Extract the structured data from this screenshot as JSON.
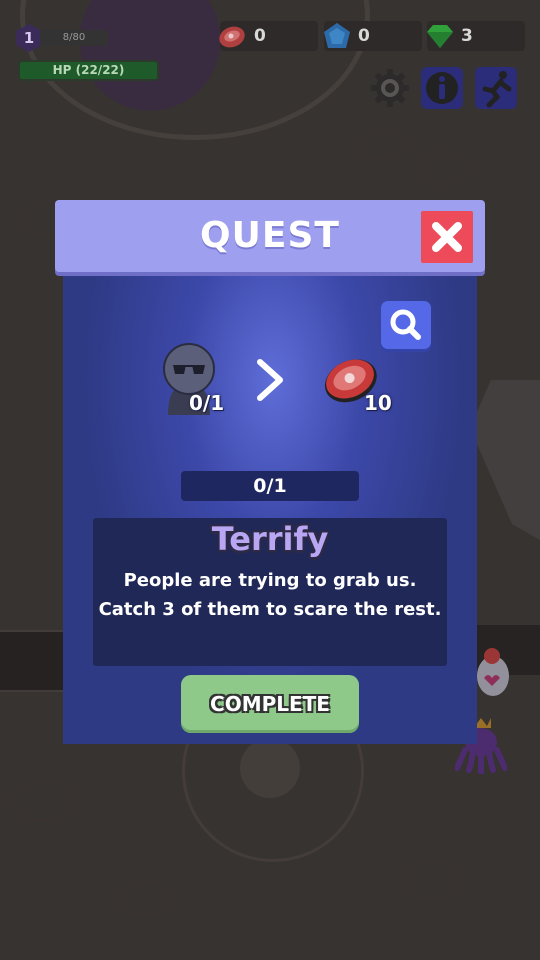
{
  "hud": {
    "level": "1",
    "xp": "8/80",
    "hp": "HP (22/22)",
    "resources": [
      {
        "name": "meat",
        "icon": "meat-icon",
        "value": "0"
      },
      {
        "name": "blue-gem",
        "icon": "blue-gem-icon",
        "value": "0"
      },
      {
        "name": "green-gem",
        "icon": "green-gem-icon",
        "value": "3"
      }
    ],
    "buttons": {
      "settings": "gear-icon",
      "info": "info-icon",
      "pose": "pose-icon"
    }
  },
  "quest": {
    "title": "QUEST",
    "target_count": "0/1",
    "reward_count": "10",
    "progress": "0/1",
    "progress_fraction": 0,
    "task_title": "Terrify",
    "task_line1": "People are trying to grab us.",
    "task_line2": "Catch 3 of them to scare the rest.",
    "complete_label": "COMPLETE"
  },
  "colors": {
    "modal_bg": "#2e3a84",
    "header": "#9f9ff0",
    "close": "#ee4b5a",
    "search": "#5468e8",
    "complete": "#8ec98a"
  }
}
